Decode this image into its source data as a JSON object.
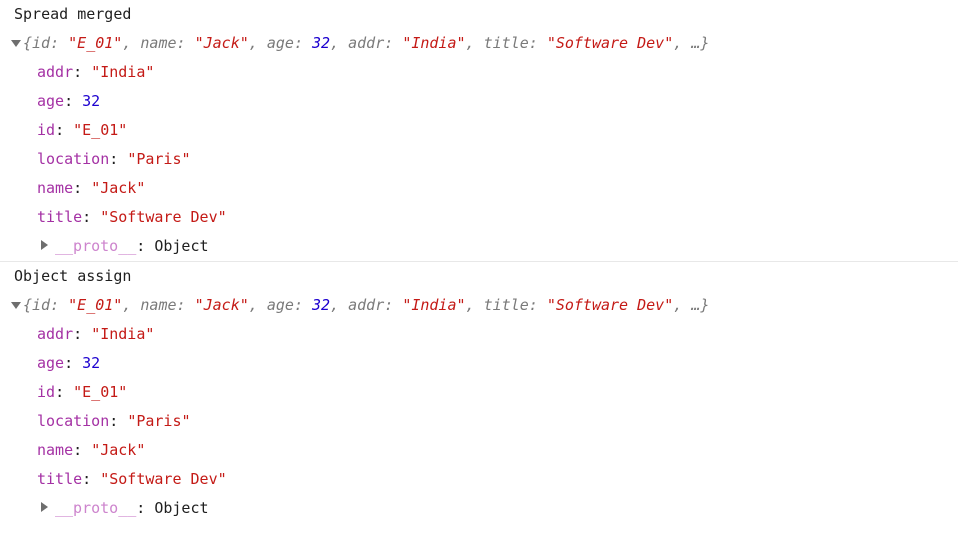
{
  "console": {
    "background_color": "#ffffff",
    "divider_color": "#e8e8e8",
    "colors": {
      "property_key": "#a431a4",
      "string_value": "#c41a16",
      "number_value": "#1c00cf",
      "preview_text": "#7a7a7a",
      "proto_key": "#cd84cd",
      "default_text": "#1f1f1f"
    },
    "groups": [
      {
        "label": "Spread merged",
        "expanded": true,
        "disclosure_icon": "triangle-down-icon",
        "preview": {
          "open_brace": "{",
          "entries": [
            {
              "key": "id",
              "sep": ": ",
              "value": "\"E_01\"",
              "type": "string"
            },
            {
              "key": "name",
              "sep": ": ",
              "value": "\"Jack\"",
              "type": "string"
            },
            {
              "key": "age",
              "sep": ": ",
              "value": "32",
              "type": "number"
            },
            {
              "key": "addr",
              "sep": ": ",
              "value": "\"India\"",
              "type": "string"
            },
            {
              "key": "title",
              "sep": ": ",
              "value": "\"Software Dev\"",
              "type": "string"
            }
          ],
          "ellipsis": "…",
          "close_brace": "}",
          "separator": ", "
        },
        "properties": [
          {
            "key": "addr",
            "value": "\"India\"",
            "type": "string"
          },
          {
            "key": "age",
            "value": "32",
            "type": "number"
          },
          {
            "key": "id",
            "value": "\"E_01\"",
            "type": "string"
          },
          {
            "key": "location",
            "value": "\"Paris\"",
            "type": "string"
          },
          {
            "key": "name",
            "value": "\"Jack\"",
            "type": "string"
          },
          {
            "key": "title",
            "value": "\"Software Dev\"",
            "type": "string"
          }
        ],
        "proto": {
          "key": "__proto__",
          "value": "Object",
          "expanded": false,
          "disclosure_icon": "triangle-right-icon"
        }
      },
      {
        "label": "Object assign",
        "expanded": true,
        "disclosure_icon": "triangle-down-icon",
        "preview": {
          "open_brace": "{",
          "entries": [
            {
              "key": "id",
              "sep": ": ",
              "value": "\"E_01\"",
              "type": "string"
            },
            {
              "key": "name",
              "sep": ": ",
              "value": "\"Jack\"",
              "type": "string"
            },
            {
              "key": "age",
              "sep": ": ",
              "value": "32",
              "type": "number"
            },
            {
              "key": "addr",
              "sep": ": ",
              "value": "\"India\"",
              "type": "string"
            },
            {
              "key": "title",
              "sep": ": ",
              "value": "\"Software Dev\"",
              "type": "string"
            }
          ],
          "ellipsis": "…",
          "close_brace": "}",
          "separator": ", "
        },
        "properties": [
          {
            "key": "addr",
            "value": "\"India\"",
            "type": "string"
          },
          {
            "key": "age",
            "value": "32",
            "type": "number"
          },
          {
            "key": "id",
            "value": "\"E_01\"",
            "type": "string"
          },
          {
            "key": "location",
            "value": "\"Paris\"",
            "type": "string"
          },
          {
            "key": "name",
            "value": "\"Jack\"",
            "type": "string"
          },
          {
            "key": "title",
            "value": "\"Software Dev\"",
            "type": "string"
          }
        ],
        "proto": {
          "key": "__proto__",
          "value": "Object",
          "expanded": false,
          "disclosure_icon": "triangle-right-icon"
        }
      }
    ]
  }
}
